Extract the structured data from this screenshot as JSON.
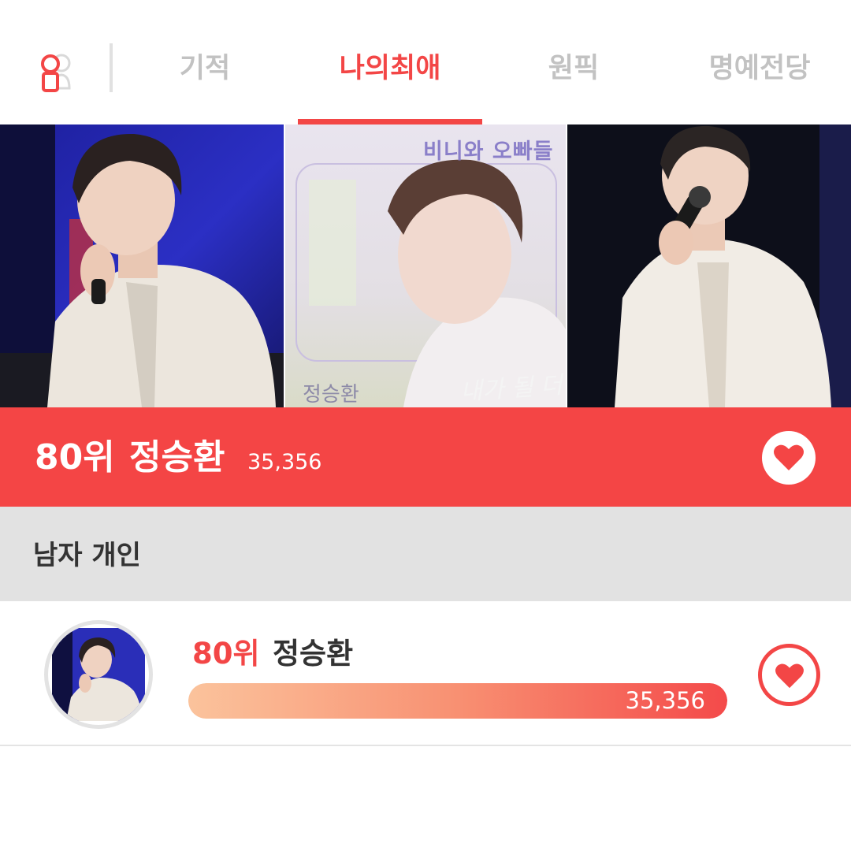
{
  "colors": {
    "accent": "#f34646",
    "banner": "#f44545",
    "inactive_tab": "#c2c2c2",
    "category_bg": "#e2e2e2"
  },
  "topbar": {
    "user_icon": "user-icon",
    "tabs": [
      {
        "label": "기적",
        "active": false
      },
      {
        "label": "나의최애",
        "active": true
      },
      {
        "label": "원픽",
        "active": false
      },
      {
        "label": "명예전당",
        "active": false
      }
    ]
  },
  "photos": {
    "album": {
      "title": "비니와 오빠들",
      "artist": "정승환",
      "song": "내가 될 더"
    }
  },
  "banner": {
    "rank": "80위",
    "name": "정승환",
    "votes": "35,356",
    "heart_icon": "heart-icon"
  },
  "category": {
    "label": "남자 개인"
  },
  "ranking_row": {
    "rank": "80위",
    "name": "정승환",
    "votes": "35,356",
    "vote_fill_fraction": 1.0,
    "heart_icon": "heart-icon"
  }
}
